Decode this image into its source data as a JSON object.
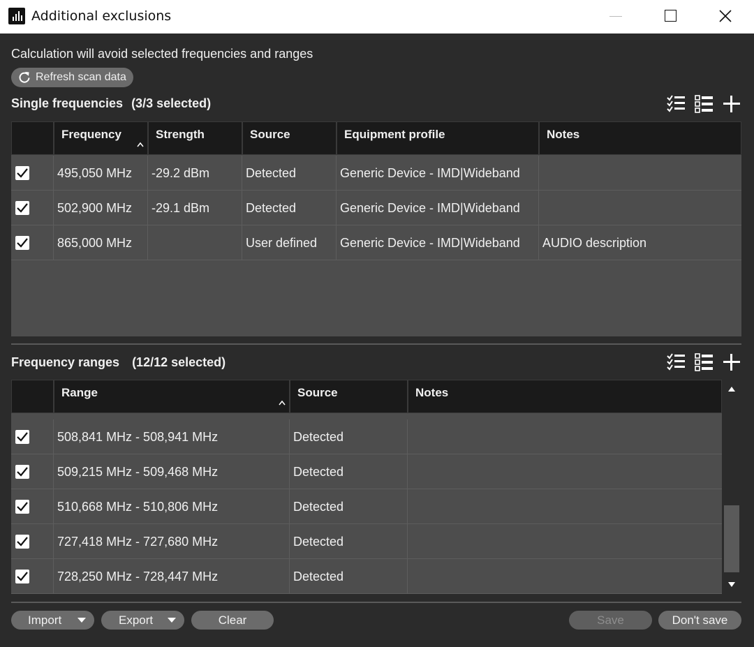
{
  "window": {
    "title": "Additional exclusions"
  },
  "header": {
    "description": "Calculation will avoid selected frequencies and ranges",
    "refresh_label": "Refresh scan data"
  },
  "single": {
    "title": "Single frequencies",
    "count": "(3/3 selected)",
    "columns": [
      "Frequency",
      "Strength",
      "Source",
      "Equipment profile",
      "Notes"
    ],
    "rows": [
      {
        "frequency": "495,050 MHz",
        "strength": "-29.2 dBm",
        "source": "Detected",
        "profile": "Generic Device - IMD|Wideband",
        "notes": ""
      },
      {
        "frequency": "502,900 MHz",
        "strength": "-29.1 dBm",
        "source": "Detected",
        "profile": "Generic Device - IMD|Wideband",
        "notes": ""
      },
      {
        "frequency": "865,000 MHz",
        "strength": "",
        "source": "User defined",
        "profile": "Generic Device - IMD|Wideband",
        "notes": "AUDIO description"
      }
    ]
  },
  "ranges": {
    "title": "Frequency ranges",
    "count": "(12/12 selected)",
    "columns": [
      "Range",
      "Source",
      "Notes"
    ],
    "rows": [
      {
        "range": "508,841 MHz - 508,941 MHz",
        "source": "Detected",
        "notes": ""
      },
      {
        "range": "509,215 MHz - 509,468 MHz",
        "source": "Detected",
        "notes": ""
      },
      {
        "range": "510,668 MHz - 510,806 MHz",
        "source": "Detected",
        "notes": ""
      },
      {
        "range": "727,418 MHz - 727,680 MHz",
        "source": "Detected",
        "notes": ""
      },
      {
        "range": "728,250 MHz - 728,447 MHz",
        "source": "Detected",
        "notes": ""
      }
    ]
  },
  "footer": {
    "import_label": "Import",
    "export_label": "Export",
    "clear_label": "Clear",
    "save_label": "Save",
    "dont_save_label": "Don't save"
  }
}
